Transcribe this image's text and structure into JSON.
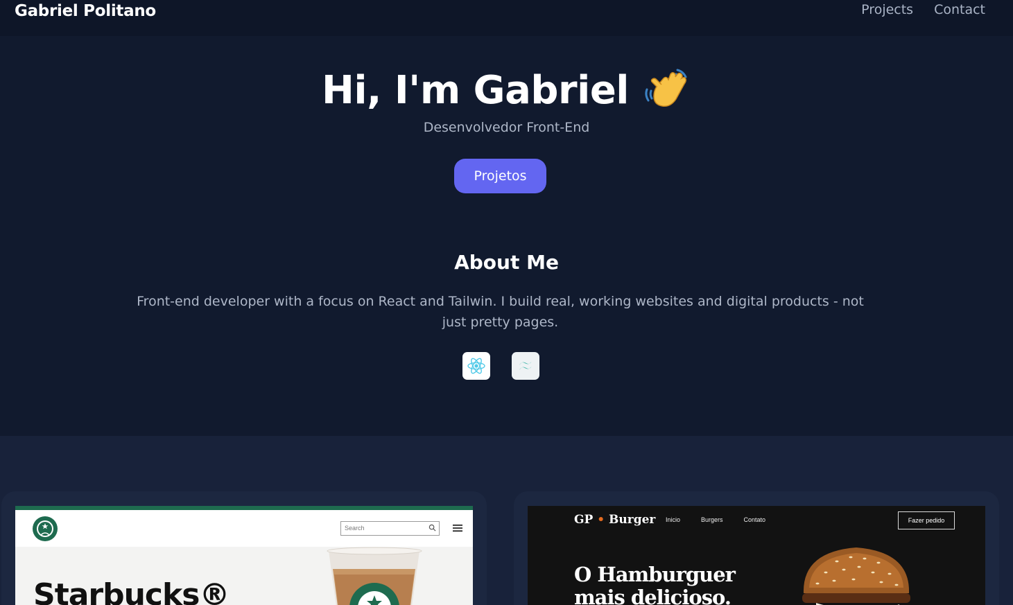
{
  "header": {
    "brand": "Gabriel Politano",
    "nav": [
      {
        "label": "Projects"
      },
      {
        "label": "Contact"
      }
    ]
  },
  "hero": {
    "title": "Hi, I'm Gabriel",
    "wave_icon": "waving-hand-icon",
    "subtitle": "Desenvolvedor Front-End",
    "cta_label": "Projetos",
    "cta_color": "#6366f1"
  },
  "about": {
    "title": "About Me",
    "text": "Front-end developer with a focus on React and Tailwin. I build real, working websites and digital products - not just pretty pages.",
    "tech_icons": [
      "react-icon",
      "tailwind-icon"
    ]
  },
  "projects": [
    {
      "thumb": {
        "search_placeholder": "Search",
        "headline": "Starbucks®"
      }
    },
    {
      "thumb": {
        "logo_left": "GP",
        "logo_dot": "•",
        "logo_right": "Burger",
        "nav": [
          "Inicio",
          "Burgers",
          "Contato"
        ],
        "button": "Fazer pedido",
        "headline_line1": "O Hamburguer",
        "headline_line2": "mais delicioso."
      }
    }
  ],
  "colors": {
    "background": "#111a2e",
    "navbar": "#0e1628",
    "projects_bg": "#18223a",
    "accent": "#6366f1"
  }
}
